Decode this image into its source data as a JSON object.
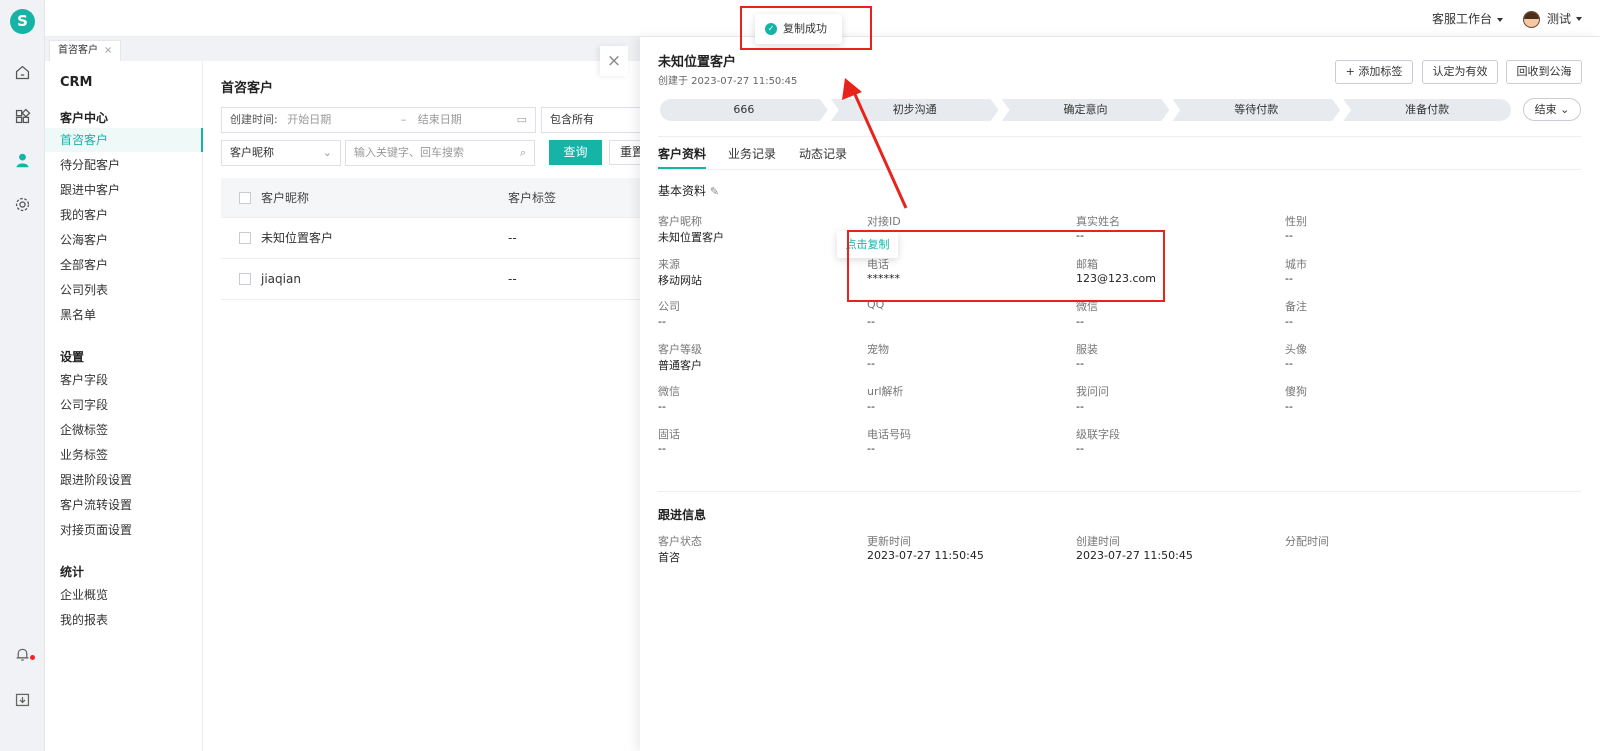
{
  "app": {
    "logo_letter": "S"
  },
  "header": {
    "workbench": "客服工作台",
    "user_name": "测试"
  },
  "tabs": [
    {
      "label": "首咨客户",
      "close": "×"
    }
  ],
  "sidebar": {
    "title": "CRM",
    "groups": [
      {
        "title": "客户中心",
        "items": [
          "首咨客户",
          "待分配客户",
          "跟进中客户",
          "我的客户",
          "公海客户",
          "全部客户",
          "公司列表",
          "黑名单"
        ]
      },
      {
        "title": "设置",
        "items": [
          "客户字段",
          "公司字段",
          "企微标签",
          "业务标签",
          "跟进阶段设置",
          "客户流转设置",
          "对接页面设置"
        ]
      },
      {
        "title": "统计",
        "items": [
          "企业概览",
          "我的报表"
        ]
      }
    ],
    "active_item": "首咨客户"
  },
  "list": {
    "title": "首咨客户",
    "created_label": "创建时间:",
    "start_placeholder": "开始日期",
    "range_sep": "–",
    "end_placeholder": "结束日期",
    "include_select": "包含所有",
    "field_select": "客户昵称",
    "search_placeholder": "输入关键字、回车搜索",
    "query_button": "查询",
    "reset_button": "重置",
    "columns": [
      "客户昵称",
      "客户标签"
    ],
    "rows": [
      {
        "name": "未知位置客户",
        "tag": "--"
      },
      {
        "name": "jiaqian",
        "tag": "--"
      }
    ]
  },
  "drawer": {
    "close": "×",
    "name": "未知位置客户",
    "created": "创建于 2023-07-27 11:50:45",
    "buttons": {
      "add_tag": "+ 添加标签",
      "mark_valid": "认定为有效",
      "to_pool": "回收到公海"
    },
    "stages": [
      "666",
      "初步沟通",
      "确定意向",
      "等待付款",
      "准备付款"
    ],
    "end_button": "结束",
    "tabs": [
      "客户资料",
      "业务记录",
      "动态记录"
    ],
    "basic_title": "基本资料",
    "fields": [
      {
        "label": "客户昵称",
        "value": "未知位置客户"
      },
      {
        "label": "对接ID",
        "value": ""
      },
      {
        "label": "真实姓名",
        "value": "--"
      },
      {
        "label": "性别",
        "value": "--"
      },
      {
        "label": "来源",
        "value": "移动网站"
      },
      {
        "label": "电话",
        "value": "******"
      },
      {
        "label": "邮箱",
        "value": "123@123.com"
      },
      {
        "label": "城市",
        "value": "--"
      },
      {
        "label": "公司",
        "value": "--"
      },
      {
        "label": "QQ",
        "value": "--"
      },
      {
        "label": "微信",
        "value": "--"
      },
      {
        "label": "备注",
        "value": "--"
      },
      {
        "label": "客户等级",
        "value": "普通客户"
      },
      {
        "label": "宠物",
        "value": "--"
      },
      {
        "label": "服装",
        "value": "--"
      },
      {
        "label": "头像",
        "value": "--"
      },
      {
        "label": "微信",
        "value": "--"
      },
      {
        "label": "url解析",
        "value": "--"
      },
      {
        "label": "我问问",
        "value": "--"
      },
      {
        "label": "傻狗",
        "value": "--"
      },
      {
        "label": "固话",
        "value": "--"
      },
      {
        "label": "电话号码",
        "value": "--"
      },
      {
        "label": "级联字段",
        "value": "--"
      }
    ],
    "copy_popover": "点击复制",
    "followup_title": "跟进信息",
    "followup": [
      {
        "label": "客户状态",
        "value": "首咨"
      },
      {
        "label": "更新时间",
        "value": "2023-07-27 11:50:45"
      },
      {
        "label": "创建时间",
        "value": "2023-07-27 11:50:45"
      },
      {
        "label": "分配时间",
        "value": ""
      }
    ]
  },
  "toast": {
    "text": "复制成功"
  },
  "colors": {
    "accent": "#16b3a7",
    "annotation": "#e8231c",
    "rail_bg": "#f0f2f5"
  }
}
